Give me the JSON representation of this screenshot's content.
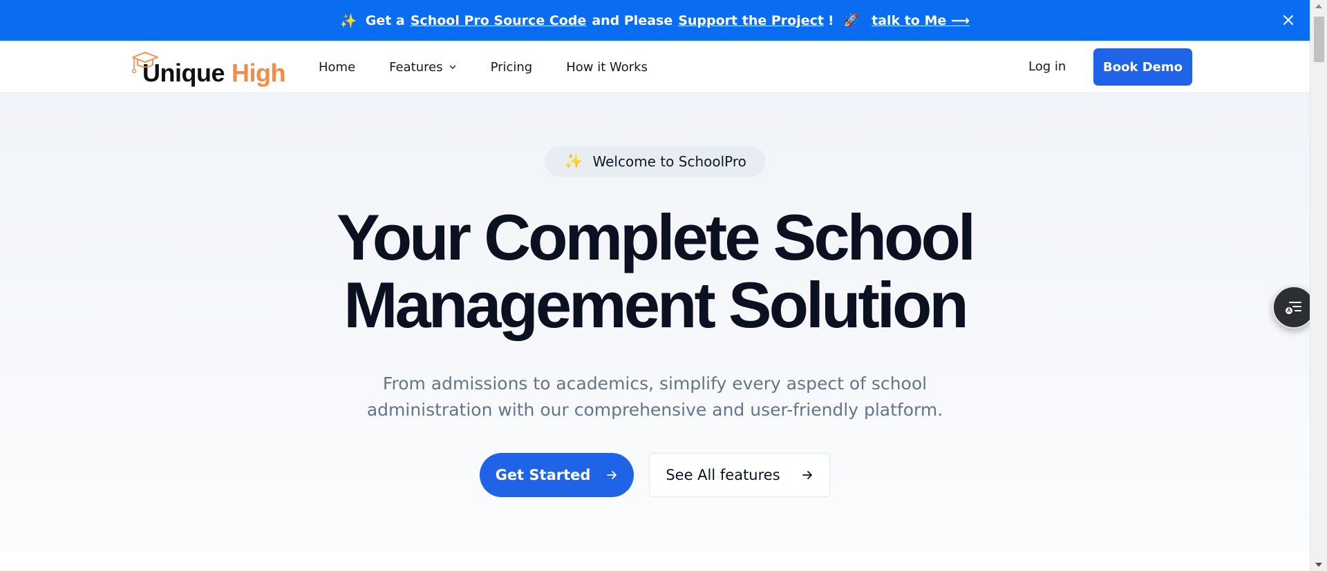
{
  "announcement": {
    "sparkle": "✨",
    "prefix": "Get a",
    "link_source": "School Pro Source Code",
    "middle": "and Please",
    "link_support": "Support the Project",
    "bang": "!",
    "rocket": "🚀",
    "link_talk": "talk to Me ⟶",
    "close_icon": "close-icon"
  },
  "header": {
    "logo": {
      "word1": "Unique",
      "word2": "High",
      "icon": "graduation-cap-icon"
    },
    "nav": [
      {
        "label": "Home"
      },
      {
        "label": "Features",
        "icon": "chevron-down-icon"
      },
      {
        "label": "Pricing"
      },
      {
        "label": "How it Works"
      }
    ],
    "login_label": "Log in",
    "book_demo_label": "Book Demo"
  },
  "hero": {
    "badge_icon": "✨",
    "badge_label": "Welcome to SchoolPro",
    "headline_line1": "Your Complete School",
    "headline_line2": "Management Solution",
    "subtext_line1": "From admissions to academics, simplify every aspect of school",
    "subtext_line2": "administration with our comprehensive and user-friendly platform.",
    "primary_cta": "Get Started",
    "secondary_cta": "See All features"
  },
  "widget": {
    "icon": "reader-list-icon"
  },
  "colors": {
    "announcement_bg": "#0a6cf0",
    "primary_blue": "#1f63e6",
    "logo_accent": "#f28c4a",
    "headline": "#0b1120",
    "subtext": "#64748b"
  }
}
